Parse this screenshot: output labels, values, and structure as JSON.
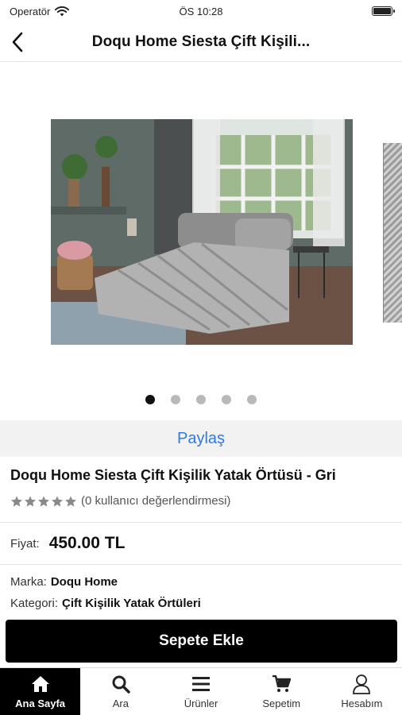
{
  "status_bar": {
    "carrier": "Operatör",
    "time": "ÖS 10:28"
  },
  "nav": {
    "title": "Doqu Home Siesta Çift Kişili..."
  },
  "gallery": {
    "page_count": 5,
    "active_index": 0
  },
  "share": {
    "label": "Paylaş"
  },
  "product": {
    "title": "Doqu Home Siesta Çift Kişilik Yatak Örtüsü - Gri",
    "rating_stars": 0,
    "rating_text": "(0 kullanıcı değerlendirmesi)",
    "price_label": "Fiyat:",
    "price_value": "450.00 TL",
    "brand_label": "Marka:",
    "brand_value": "Doqu Home",
    "category_label": "Kategori:",
    "category_value": "Çift Kişilik Yatak Örtüleri"
  },
  "actions": {
    "add_to_cart": "Sepete Ekle"
  },
  "tabs": [
    {
      "label": "Ana Sayfa",
      "icon": "home-icon",
      "active": true
    },
    {
      "label": "Ara",
      "icon": "search-icon",
      "active": false
    },
    {
      "label": "Ürünler",
      "icon": "menu-icon",
      "active": false
    },
    {
      "label": "Sepetim",
      "icon": "cart-icon",
      "active": false
    },
    {
      "label": "Hesabım",
      "icon": "user-icon",
      "active": false
    }
  ],
  "colors": {
    "accent": "#2c7be5",
    "primary_button": "#000000",
    "share_bg": "#f2f2f2"
  }
}
